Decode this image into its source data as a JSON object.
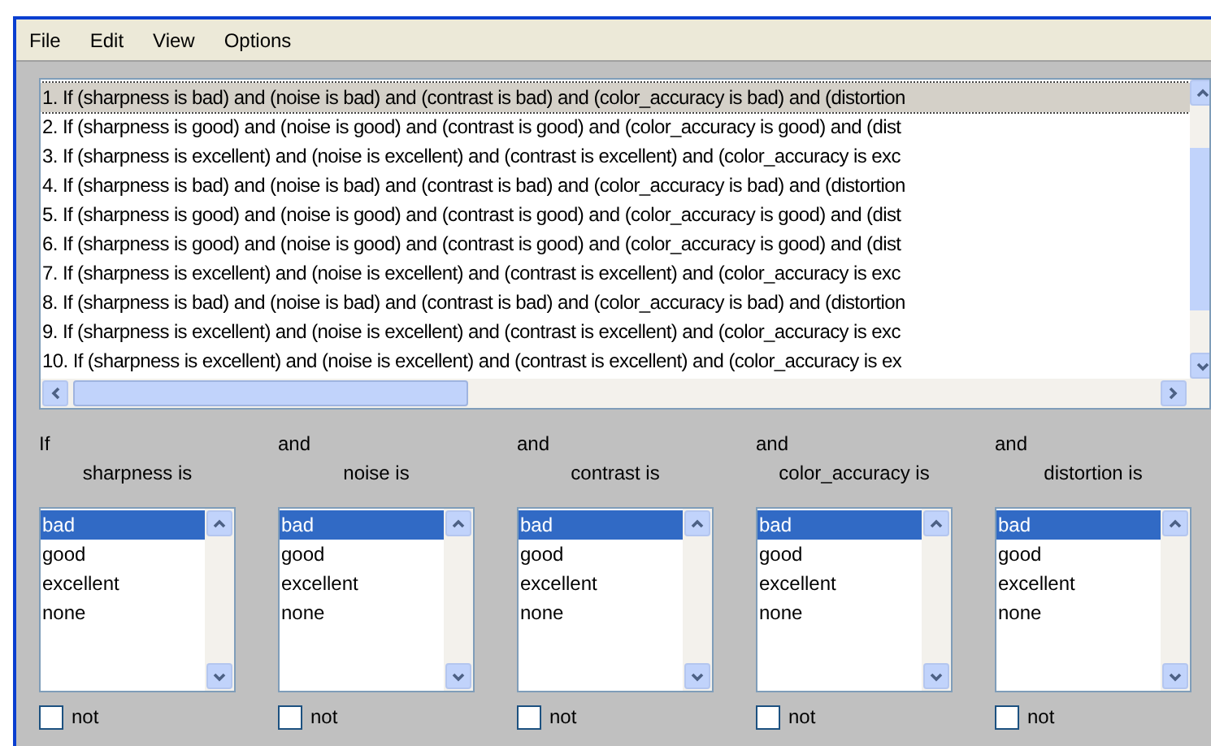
{
  "menu": [
    "File",
    "Edit",
    "View",
    "Options"
  ],
  "rules": [
    {
      "text": "1. If (sharpness is bad) and (noise is bad) and (contrast is bad) and (color_accuracy is bad) and (distortion",
      "selected": true
    },
    {
      "text": "2. If (sharpness is good) and (noise is good) and (contrast is good) and (color_accuracy is good) and (dist",
      "selected": false
    },
    {
      "text": "3. If (sharpness is excellent) and (noise is excellent) and (contrast is excellent) and (color_accuracy is exc",
      "selected": false
    },
    {
      "text": "4. If (sharpness is bad) and (noise is bad) and (contrast is bad) and (color_accuracy is bad) and (distortion",
      "selected": false
    },
    {
      "text": "5. If (sharpness is good) and (noise is good) and (contrast is good) and (color_accuracy is good) and (dist",
      "selected": false
    },
    {
      "text": "6. If (sharpness is good) and (noise is good) and (contrast is good) and (color_accuracy is good) and (dist",
      "selected": false
    },
    {
      "text": "7. If (sharpness is excellent) and (noise is excellent) and (contrast is excellent) and (color_accuracy is exc",
      "selected": false
    },
    {
      "text": "8. If (sharpness is bad) and (noise is bad) and (contrast is bad) and (color_accuracy is bad) and (distortion",
      "selected": false
    },
    {
      "text": "9. If (sharpness is excellent) and (noise is excellent) and (contrast is excellent) and (color_accuracy is exc",
      "selected": false
    },
    {
      "text": "10. If (sharpness is excellent) and (noise is excellent) and (contrast is excellent) and (color_accuracy is ex",
      "selected": false
    }
  ],
  "conditions": [
    {
      "connector": "If",
      "label": "sharpness is",
      "options": [
        {
          "label": "bad",
          "selected": true
        },
        {
          "label": "good",
          "selected": false
        },
        {
          "label": "excellent",
          "selected": false
        },
        {
          "label": "none",
          "selected": false
        }
      ],
      "negate": {
        "label": "not",
        "checked": false
      }
    },
    {
      "connector": "and",
      "label": "noise is",
      "options": [
        {
          "label": "bad",
          "selected": true
        },
        {
          "label": "good",
          "selected": false
        },
        {
          "label": "excellent",
          "selected": false
        },
        {
          "label": "none",
          "selected": false
        }
      ],
      "negate": {
        "label": "not",
        "checked": false
      }
    },
    {
      "connector": "and",
      "label": "contrast is",
      "options": [
        {
          "label": "bad",
          "selected": true
        },
        {
          "label": "good",
          "selected": false
        },
        {
          "label": "excellent",
          "selected": false
        },
        {
          "label": "none",
          "selected": false
        }
      ],
      "negate": {
        "label": "not",
        "checked": false
      }
    },
    {
      "connector": "and",
      "label": "color_accuracy is",
      "options": [
        {
          "label": "bad",
          "selected": true
        },
        {
          "label": "good",
          "selected": false
        },
        {
          "label": "excellent",
          "selected": false
        },
        {
          "label": "none",
          "selected": false
        }
      ],
      "negate": {
        "label": "not",
        "checked": false
      }
    },
    {
      "connector": "and",
      "label": "distortion is",
      "options": [
        {
          "label": "bad",
          "selected": true
        },
        {
          "label": "good",
          "selected": false
        },
        {
          "label": "excellent",
          "selected": false
        },
        {
          "label": "none",
          "selected": false
        }
      ],
      "negate": {
        "label": "not",
        "checked": false
      }
    }
  ]
}
